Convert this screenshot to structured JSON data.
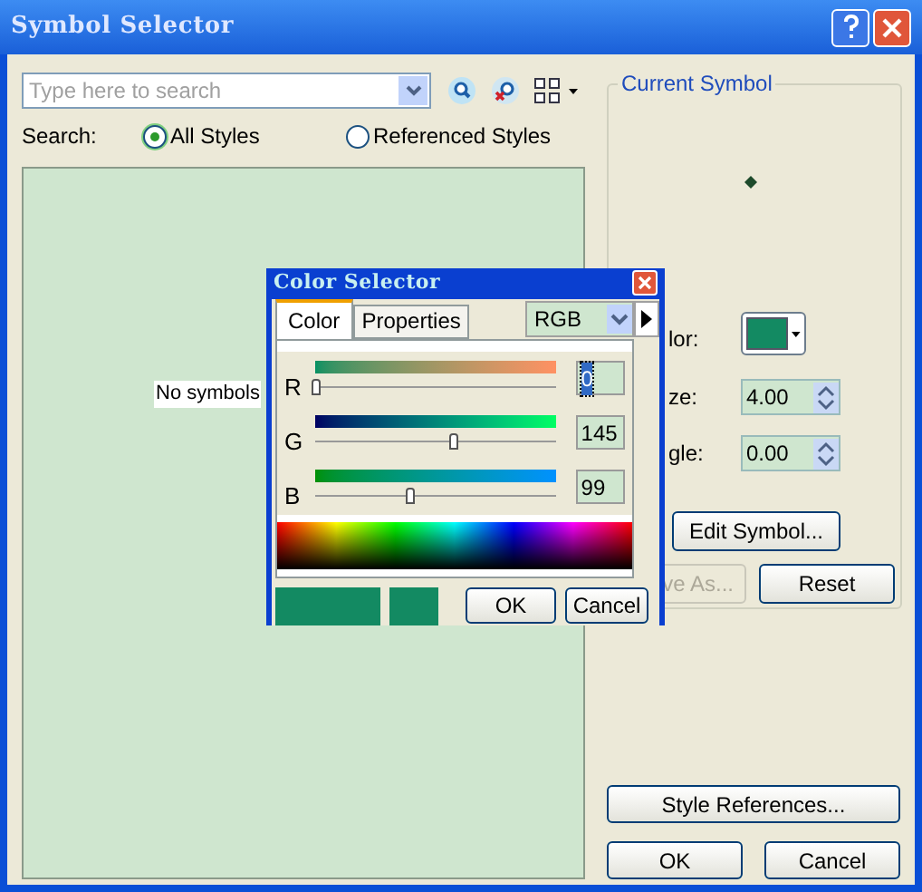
{
  "window": {
    "title": "Symbol Selector"
  },
  "search": {
    "placeholder": "Type here to search",
    "scope_label": "Search:",
    "scopes": [
      {
        "label": "All Styles",
        "selected": true
      },
      {
        "label": "Referenced Styles",
        "selected": false
      }
    ]
  },
  "symbol_list": {
    "empty_text": "No symbols"
  },
  "current_symbol": {
    "title": "Current Symbol",
    "color_label": "lor:",
    "size_label": "ze:",
    "size": "4.00",
    "angle_label": "gle:",
    "angle": "0.00",
    "buttons": [
      {
        "label": "Edit Symbol...",
        "disabled": false
      },
      {
        "label": "ve As...",
        "disabled": true
      },
      {
        "label": "Reset",
        "disabled": false
      }
    ]
  },
  "style_references_button": "Style References...",
  "footer_buttons": [
    "OK",
    "Cancel"
  ],
  "color_selector": {
    "title": "Color Selector",
    "tabs": [
      {
        "label": "Color",
        "selected": true
      },
      {
        "label": "Properties",
        "selected": false
      }
    ],
    "model": "RGB",
    "channels": [
      {
        "name": "R",
        "level": 0,
        "value": "0",
        "focused": true
      },
      {
        "name": "G",
        "level": 0.57,
        "value": "145",
        "focused": false
      },
      {
        "name": "B",
        "level": 0.39,
        "value": "99",
        "focused": false
      }
    ],
    "buttons": [
      "OK",
      "Cancel"
    ]
  }
}
